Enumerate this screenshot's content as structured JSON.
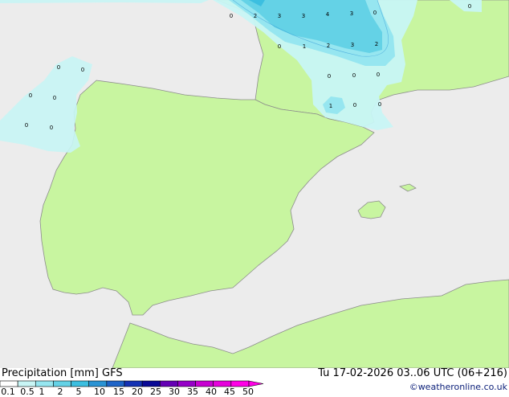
{
  "map": {
    "colors": {
      "sea": "#ececec",
      "land": "#c8f5a0",
      "coast": "#8c8c8c",
      "precip_light": "#c8f5f5",
      "precip_1": "#96e6f0",
      "precip_2": "#64d2e6",
      "precip_5": "#3cbfe0"
    },
    "contour_labels": [
      {
        "id": "l1",
        "text": "0"
      },
      {
        "id": "l2",
        "text": "2"
      },
      {
        "id": "l3",
        "text": "3"
      },
      {
        "id": "l4",
        "text": "3"
      },
      {
        "id": "l5",
        "text": "4"
      },
      {
        "id": "l6",
        "text": "3"
      },
      {
        "id": "l7",
        "text": "0"
      },
      {
        "id": "l8",
        "text": "0"
      },
      {
        "id": "l9",
        "text": "0"
      },
      {
        "id": "l10",
        "text": "1"
      },
      {
        "id": "l11",
        "text": "2"
      },
      {
        "id": "l12",
        "text": "3"
      },
      {
        "id": "l13",
        "text": "2"
      },
      {
        "id": "l14",
        "text": "0"
      },
      {
        "id": "l15",
        "text": "0"
      },
      {
        "id": "l16",
        "text": "0"
      },
      {
        "id": "l17",
        "text": "1"
      },
      {
        "id": "l18",
        "text": "0"
      },
      {
        "id": "l19",
        "text": "0"
      },
      {
        "id": "l20",
        "text": "0"
      },
      {
        "id": "l21",
        "text": "0"
      },
      {
        "id": "l22",
        "text": "0"
      },
      {
        "id": "l23",
        "text": "0"
      },
      {
        "id": "l24",
        "text": "0"
      },
      {
        "id": "l25",
        "text": "0"
      }
    ]
  },
  "footer": {
    "title": "Precipitation [mm] GFS",
    "datetime": "Tu 17-02-2026 03..06 UTC (06+216)",
    "credit": "©weatheronline.co.uk",
    "legend": {
      "ticks": [
        "0.1",
        "0.5",
        "1",
        "2",
        "5",
        "10",
        "15",
        "20",
        "25",
        "30",
        "35",
        "40",
        "45",
        "50"
      ],
      "colors": [
        "#ffffff",
        "#c8f5f5",
        "#96e6f0",
        "#64d2e6",
        "#3cbfe0",
        "#2a93d4",
        "#1e64c8",
        "#1432b4",
        "#0a0a96",
        "#6400b4",
        "#9600c8",
        "#c800d2",
        "#e600dc",
        "#ff00e6"
      ]
    }
  }
}
